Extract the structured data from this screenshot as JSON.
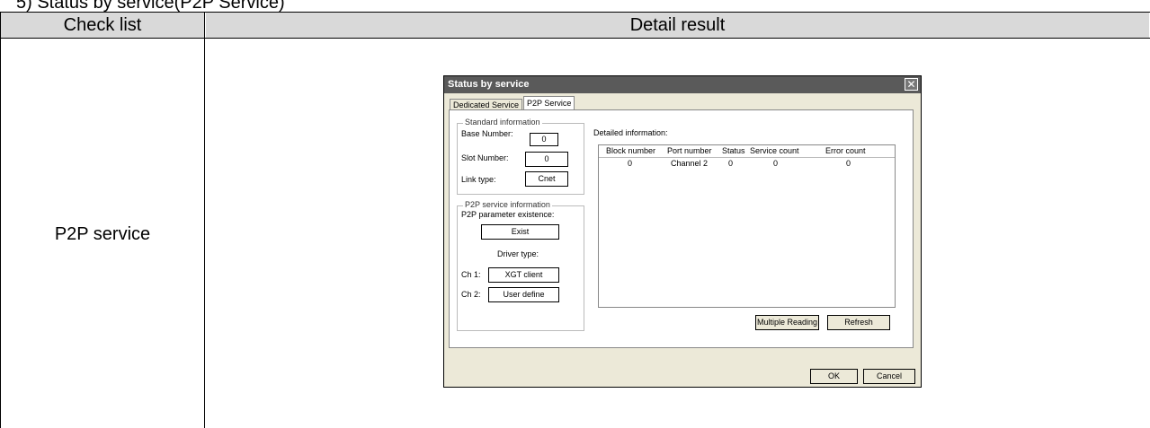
{
  "section_title": "5) Status by service(P2P Service)",
  "table": {
    "headers": [
      "Check list",
      "Detail result"
    ],
    "row_label": "P2P service"
  },
  "dialog": {
    "title": "Status by service",
    "close_glyph": "✕",
    "tabs": [
      "Dedicated Service",
      "P2P Service"
    ],
    "standard": {
      "group_title": "Standard information",
      "base_label": "Base Number:",
      "base_value": "0",
      "slot_label": "Slot Number:",
      "slot_value": "0",
      "link_label": "Link type:",
      "link_value": "Cnet"
    },
    "p2p": {
      "group_title": "P2P service information",
      "existence_label": "P2P parameter existence:",
      "existence_value": "Exist",
      "driver_label": "Driver type:",
      "ch1_label": "Ch 1:",
      "ch1_value": "XGT client",
      "ch2_label": "Ch 2:",
      "ch2_value": "User define"
    },
    "detail_label": "Detailed information:",
    "list": {
      "columns": [
        "Block number",
        "Port number",
        "Status",
        "Service count",
        "Error count"
      ],
      "rows": [
        [
          "0",
          "Channel 2",
          "0",
          "0",
          "0"
        ]
      ]
    },
    "buttons": {
      "multiple_reading": "Multiple Reading",
      "refresh": "Refresh",
      "ok": "OK",
      "cancel": "Cancel"
    }
  }
}
